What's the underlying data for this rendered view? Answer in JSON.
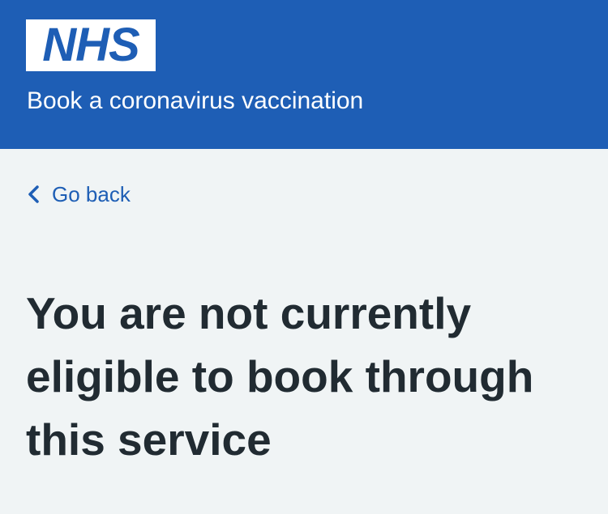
{
  "header": {
    "logo_text": "NHS",
    "service_name": "Book a coronavirus vaccination",
    "background_color": "#1e5eb5"
  },
  "navigation": {
    "back_label": "Go back",
    "back_icon": "chevron-left-icon"
  },
  "main": {
    "heading": "You are not currently eligible to book through this service"
  },
  "colors": {
    "page_background": "#f0f4f5",
    "link": "#1e5eb5",
    "text": "#212b32"
  }
}
